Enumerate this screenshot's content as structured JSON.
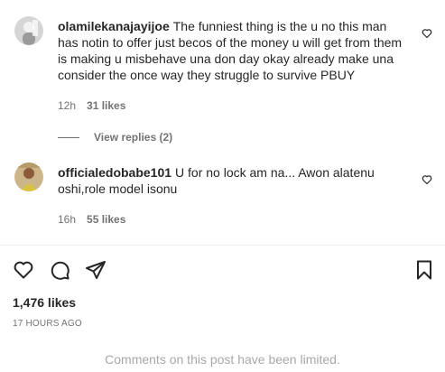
{
  "comments": [
    {
      "username": "olamilekanajayijoe",
      "text": "The funniest thing is the u no this man has notin to offer just becos of the money u will get from them is making u misbehave una don day okay already make una consider the once way they struggle to survive PBUY",
      "time": "12h",
      "likes": "31 likes",
      "view_replies": "View replies (2)"
    },
    {
      "username": "officialedobabe101",
      "text": "U for no lock am na... Awon alatenu oshi,role model isonu",
      "time": "16h",
      "likes": "55 likes"
    }
  ],
  "post": {
    "likes": "1,476 likes",
    "time_ago": "17 HOURS AGO",
    "comments_limited": "Comments on this post have been limited."
  },
  "icons": {
    "like": "heart-icon",
    "comment": "comment-bubble-icon",
    "share": "paper-plane-icon",
    "save": "bookmark-icon"
  }
}
